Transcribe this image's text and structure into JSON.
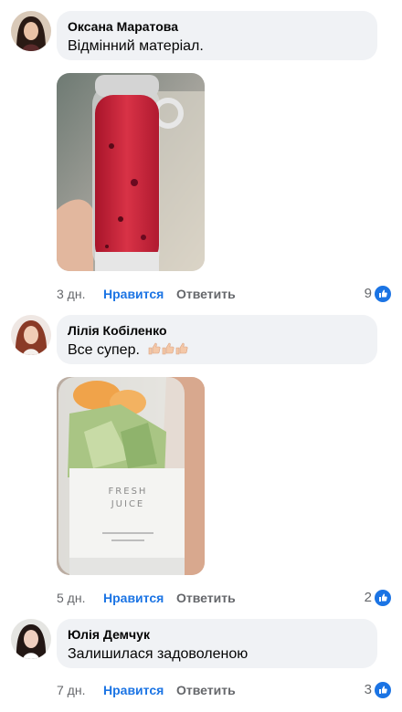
{
  "comments": [
    {
      "author": "Оксана Маратова",
      "text": "Відмінний матеріал.",
      "time": "3 дн.",
      "like_label": "Нравится",
      "reply_label": "Ответить",
      "reactions": "9",
      "avatar": "avatar-woman-dark-hair",
      "photo": "photo-red-smoothie-blender-bottle"
    },
    {
      "author": "Лілія Кобіленко",
      "text": "Все супер.",
      "emoji": [
        "thumbs-up-icon",
        "thumbs-up-icon",
        "thumbs-up-icon"
      ],
      "time": "5 дн.",
      "like_label": "Нравится",
      "reply_label": "Ответить",
      "reactions": "2",
      "avatar": "avatar-woman-auburn-hair",
      "photo": "photo-fresh-juice-blender-with-fruit",
      "photo_label": [
        "FRESH",
        "JUICE"
      ]
    },
    {
      "author": "Юлія Демчук",
      "text": "Залишилася задоволеною",
      "time": "7 дн.",
      "like_label": "Нравится",
      "reply_label": "Ответить",
      "reactions": "3",
      "avatar": "avatar-woman-long-dark-hair"
    }
  ],
  "colors": {
    "bubble": "#f0f2f5",
    "like_blue": "#1b74e4",
    "meta_gray": "#65676b",
    "text": "#050505"
  }
}
